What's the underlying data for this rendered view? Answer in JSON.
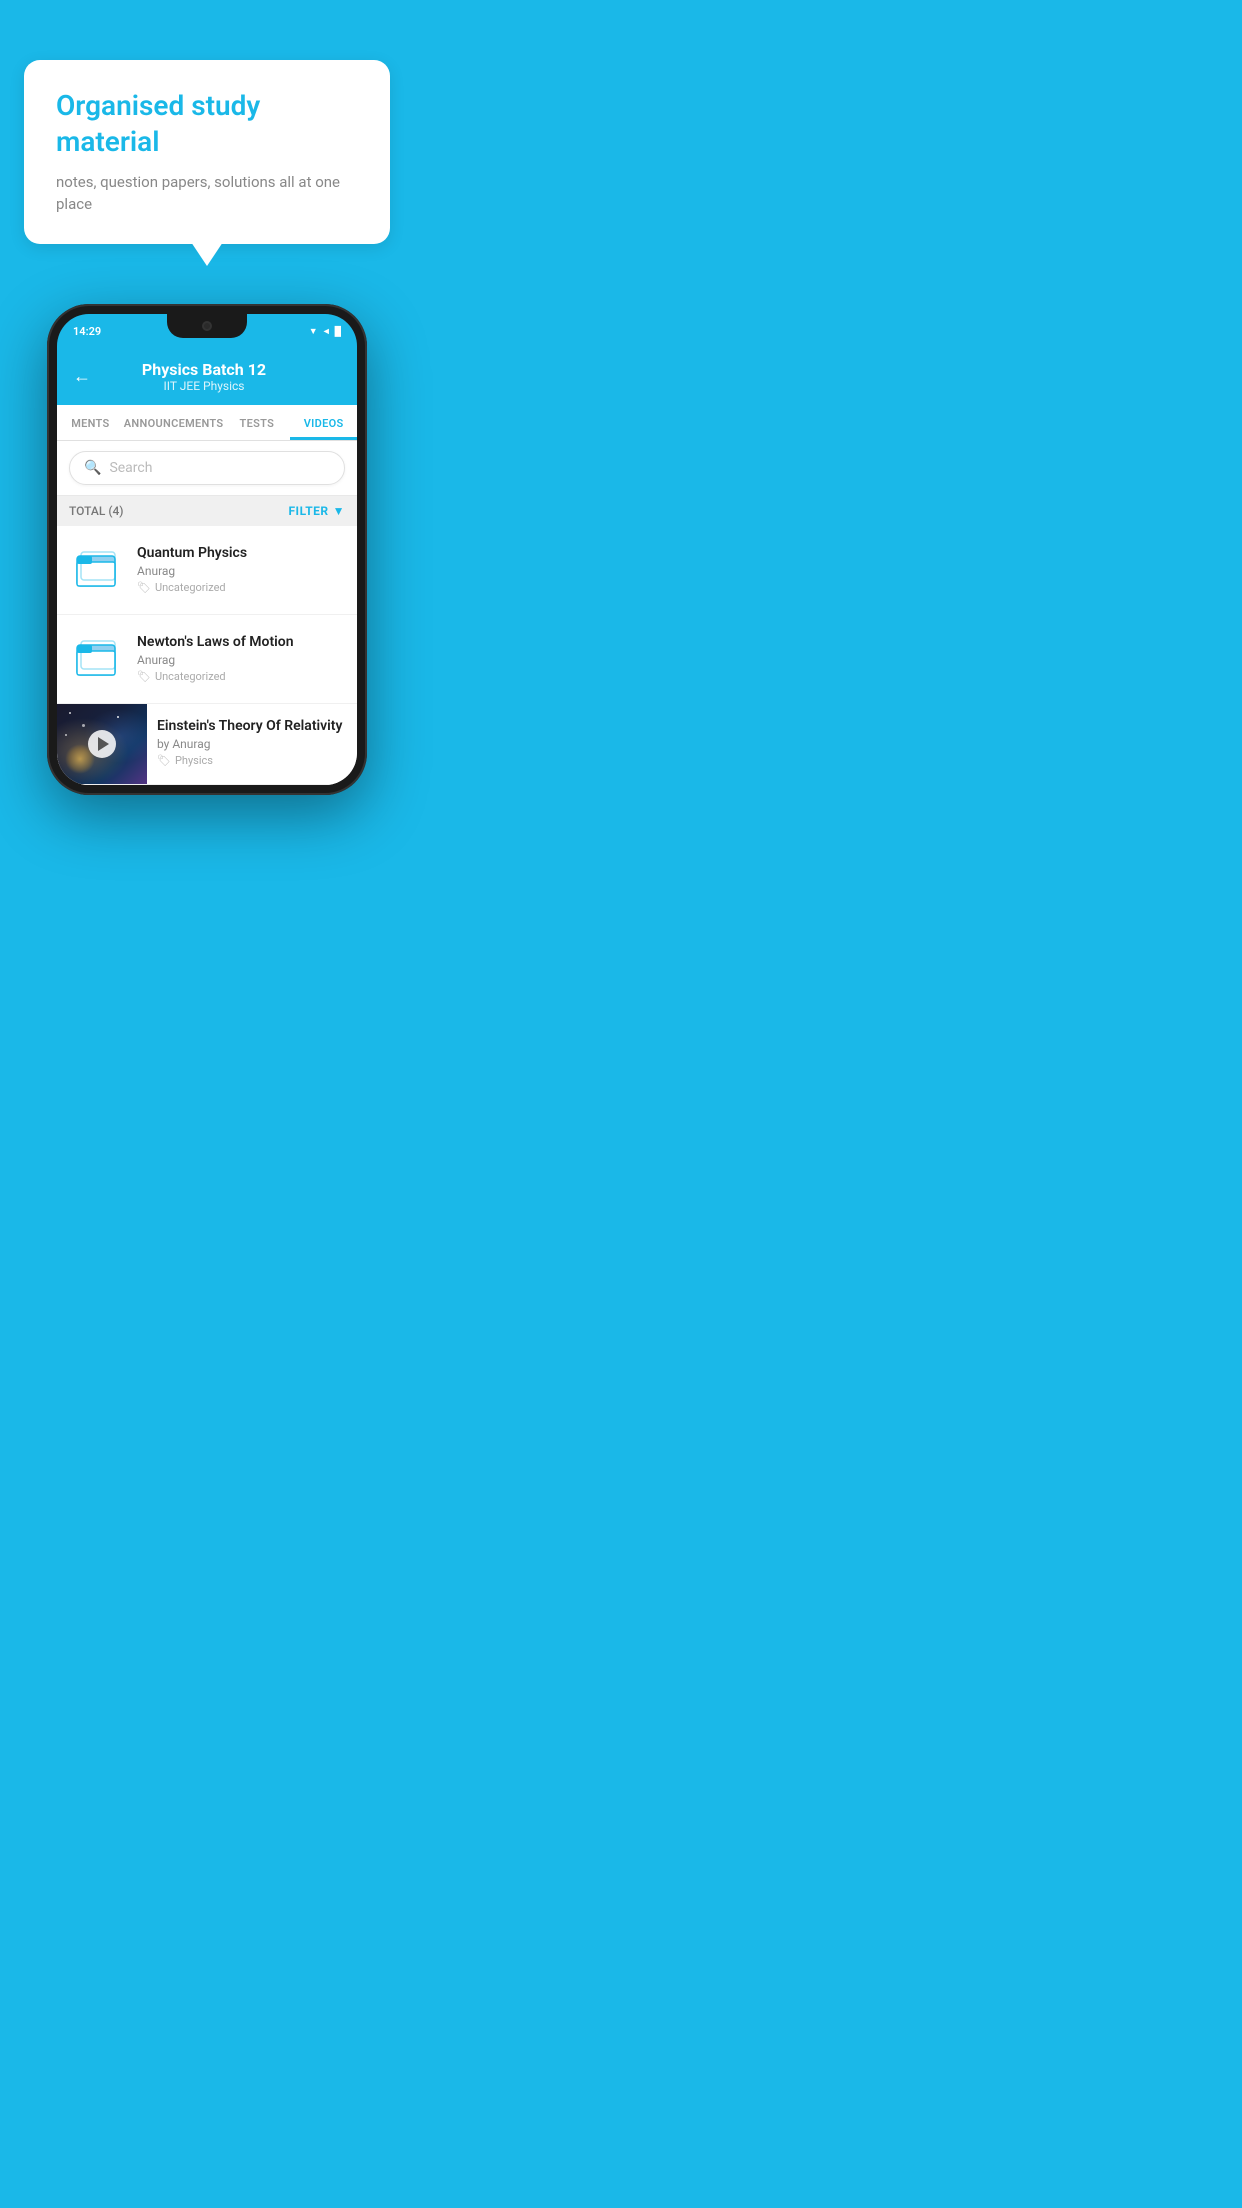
{
  "promo": {
    "title": "Organised study material",
    "subtitle": "notes, question papers, solutions all at one place"
  },
  "status_bar": {
    "time": "14:29",
    "icons": "▼◄█"
  },
  "header": {
    "title": "Physics Batch 12",
    "subtitle": "IIT JEE   Physics",
    "back_label": "←"
  },
  "tabs": [
    {
      "label": "MENTS",
      "active": false
    },
    {
      "label": "ANNOUNCEMENTS",
      "active": false
    },
    {
      "label": "TESTS",
      "active": false
    },
    {
      "label": "VIDEOS",
      "active": true
    }
  ],
  "search": {
    "placeholder": "Search"
  },
  "filter_bar": {
    "total": "TOTAL (4)",
    "filter_label": "FILTER"
  },
  "videos": [
    {
      "title": "Quantum Physics",
      "author": "Anurag",
      "tag": "Uncategorized",
      "type": "folder"
    },
    {
      "title": "Newton's Laws of Motion",
      "author": "Anurag",
      "tag": "Uncategorized",
      "type": "folder"
    },
    {
      "title": "Einstein's Theory Of Relativity",
      "author": "by Anurag",
      "tag": "Physics",
      "type": "video"
    }
  ],
  "colors": {
    "primary": "#1ab8e8",
    "text_dark": "#222222",
    "text_grey": "#888888",
    "bg_light": "#f5f5f5"
  }
}
